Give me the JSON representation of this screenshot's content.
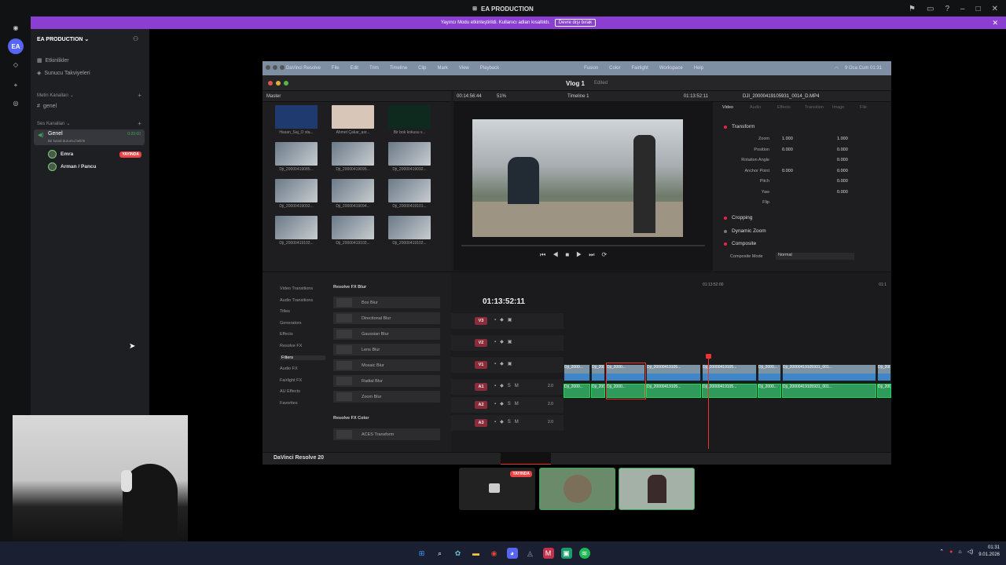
{
  "window": {
    "title": "EA PRODUCTION"
  },
  "notice": {
    "text": "Yayıncı Modu etkinleştirildi. Kullanıcı adları kısaltıldı.",
    "button": "Devre dışı bırak"
  },
  "sidebar": {
    "server_name": "EA PRODUCTION",
    "items": [
      {
        "label": "Etkinlikler",
        "icon": "calendar-icon"
      },
      {
        "label": "Sunucu Takviyeleri",
        "icon": "boost-icon"
      }
    ],
    "text_category": "Metin Kanalları",
    "text_channels": [
      {
        "label": "genel"
      }
    ],
    "voice_category": "Ses Kanalları",
    "voice_channel": {
      "label": "Genel",
      "subtitle": "Bir kanal durumu belirle",
      "counter": "0:20:60"
    },
    "voice_users": [
      {
        "name": "Emra",
        "badge": "YAYINDA"
      },
      {
        "name": "Arman / Pancu",
        "badge": ""
      }
    ]
  },
  "resolve": {
    "menu": [
      "DaVinci Resolve",
      "File",
      "Edit",
      "Trim",
      "Timeline",
      "Clip",
      "Mark",
      "View",
      "Playback",
      "Fusion",
      "Color",
      "Fairlight",
      "Workspace",
      "Help"
    ],
    "menu_right": "9 Oca Cum  01:31",
    "project": "Vlog 1",
    "project_status": "Edited",
    "media_pool_label": "Master",
    "zoom": "51%",
    "source_tc": "00:14:56:44",
    "timeline_name": "Timeline 1",
    "viewer_tc": "01:13:52:11",
    "clip_name": "DJI_20000419105931_0014_D.MP4",
    "inspector_tabs": [
      "Video",
      "Audio",
      "Effects",
      "Transition",
      "Image",
      "File"
    ],
    "transform_label": "Transform",
    "transform": [
      {
        "label": "Zoom",
        "x": "1.000",
        "y": "1.000"
      },
      {
        "label": "Position",
        "x": "0.000",
        "y": "0.000"
      },
      {
        "label": "Rotation Angle",
        "x": "",
        "y": "0.000"
      },
      {
        "label": "Anchor Point",
        "x": "0.000",
        "y": "0.000"
      },
      {
        "label": "Pitch",
        "x": "",
        "y": "0.000"
      },
      {
        "label": "Yaw",
        "x": "",
        "y": "0.000"
      },
      {
        "label": "Flip",
        "x": "",
        "y": ""
      }
    ],
    "sections": [
      "Cropping",
      "Dynamic Zoom",
      "Composite"
    ],
    "composite_mode_label": "Composite Mode",
    "composite_mode": "Normal",
    "thumbs": [
      "Hasan_Saj_O sta...",
      "Ahmet Çakar_asr...",
      "Bir bok kokusu v...",
      "Dji_20000419085...",
      "Dji_20000419095...",
      "Dji_20000419092...",
      "Dji_20000419092...",
      "Dji_20000419094...",
      "Dji_20000419101...",
      "Dji_20000419102...",
      "Dji_20000419102...",
      "Dji_20000419102..."
    ],
    "fx_categories": [
      "Video Transitions",
      "Audio Transitions",
      "Titles",
      "Generators",
      "Effects",
      "Resolve FX",
      "Filters",
      "Audio FX",
      "Fairlight FX",
      "AU Effects",
      "Favorites"
    ],
    "fx_group": "Resolve FX Blur",
    "fx_items": [
      "Box Blur",
      "Directional Blur",
      "Gaussian Blur",
      "Lens Blur",
      "Mosaic Blur",
      "Radial Blur",
      "Zoom Blur"
    ],
    "fx_group2": "Resolve FX Color",
    "fx_items2": [
      "ACES Transform"
    ],
    "timecode": "01:13:52:11",
    "ruler_tc": "01:13:52:00",
    "ruler_tc_right": "01:1",
    "tracks_video": [
      "V3",
      "V2",
      "V1"
    ],
    "tracks_audio": [
      {
        "name": "A1",
        "ch": "2.0"
      },
      {
        "name": "A2",
        "ch": "2.0"
      },
      {
        "name": "A3",
        "ch": "2.0"
      }
    ],
    "clip_label": "Dji_2000...",
    "long_clip_label": "Dji_20000419105...",
    "longest_clip_label": "Dji_20000419105931_001...",
    "brand": "DaVinci Resolve 20"
  },
  "stream": {
    "live_badge": "YAYINDA"
  },
  "taskbar": {
    "time": "01:31",
    "date": "9.01.2026"
  },
  "colors": {
    "notice_bg": "#8a3fd1",
    "live_red": "#ed4245",
    "video_clip": "#3f86c8",
    "audio_clip": "#2f9a5a"
  }
}
